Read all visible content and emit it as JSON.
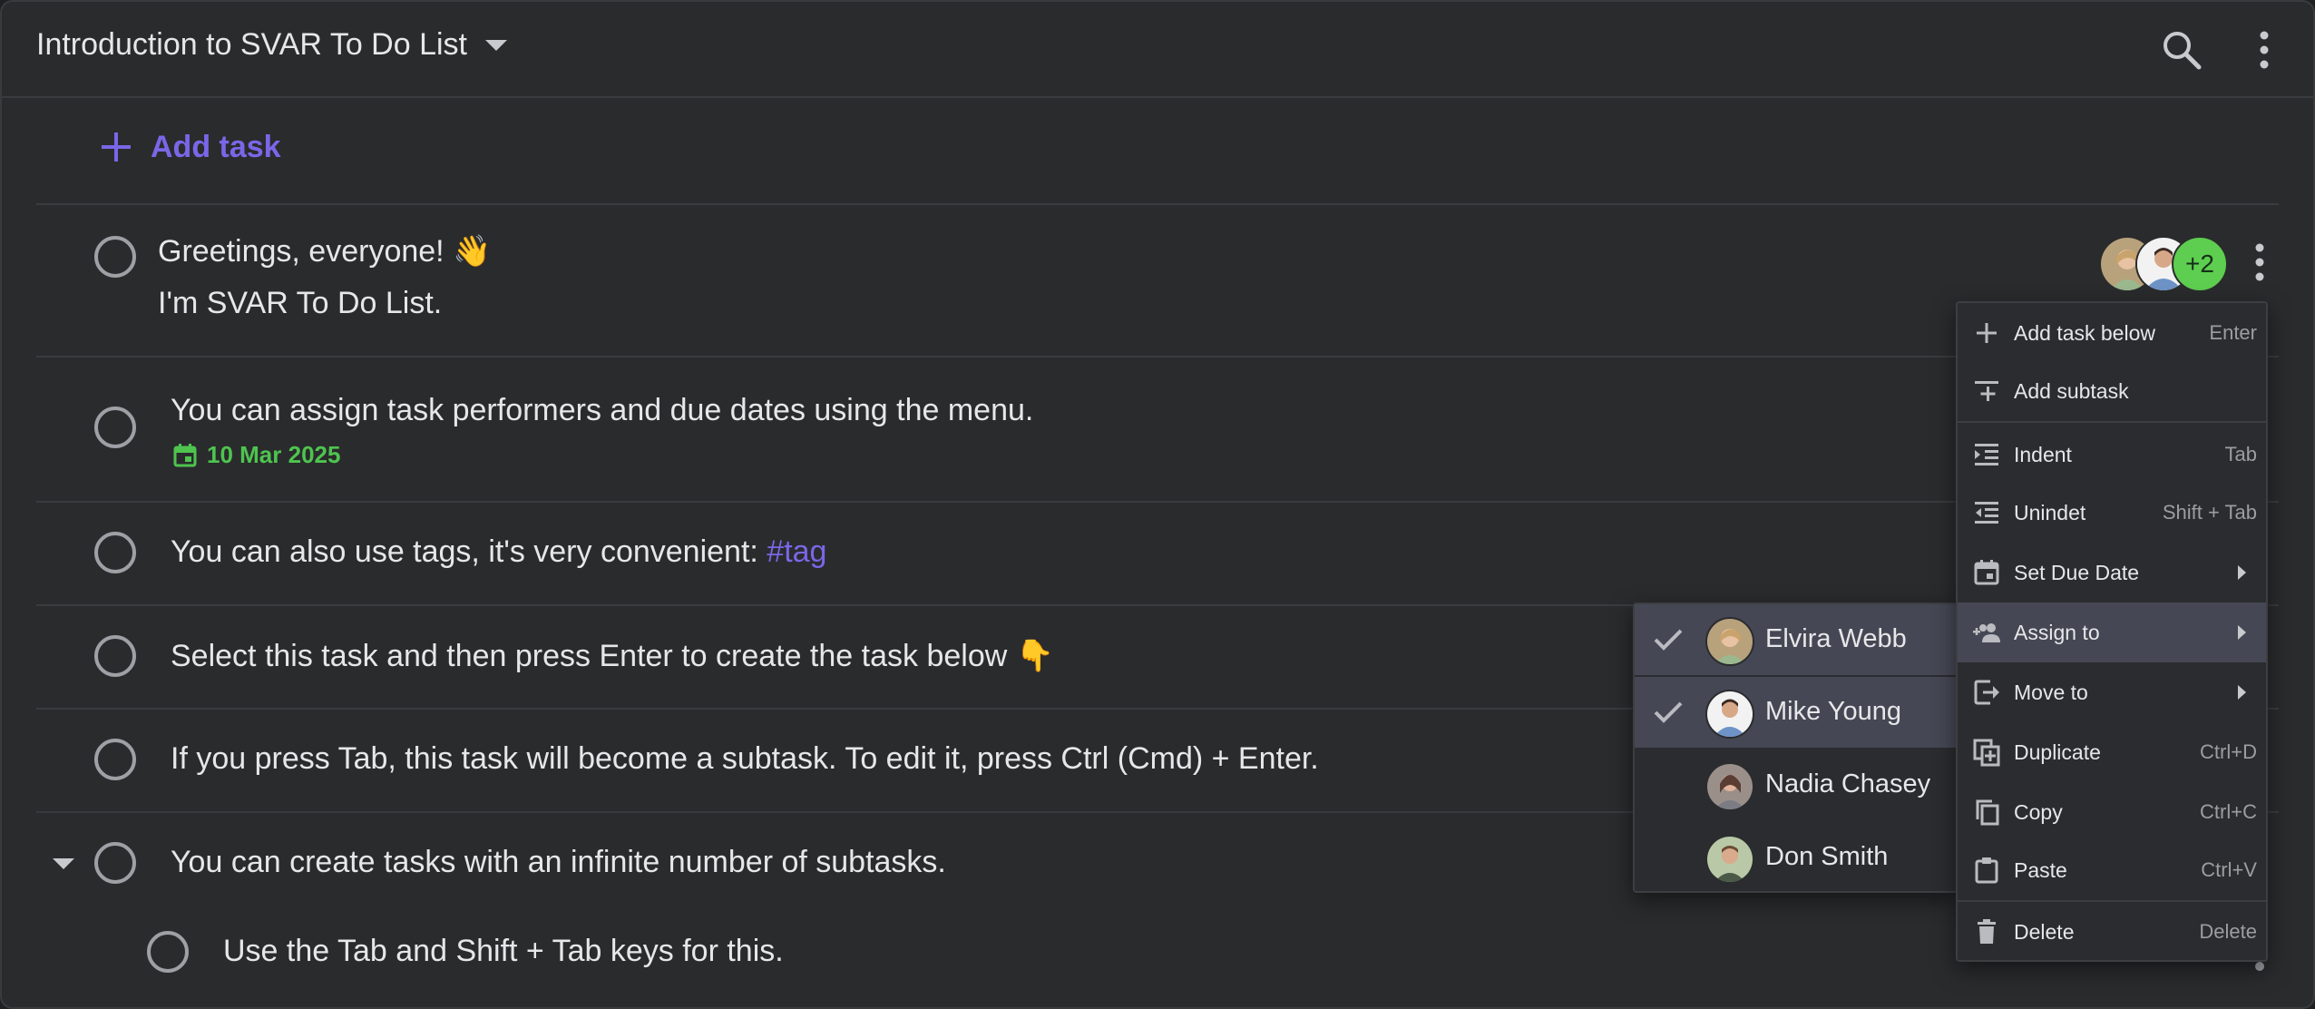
{
  "header": {
    "title": "Introduction to SVAR To Do List",
    "search_icon": "search-icon",
    "more_icon": "more-vertical-icon"
  },
  "add_task_label": "Add task",
  "tasks": [
    {
      "line1": "Greetings, everyone! 👋",
      "line2": "I'm SVAR To Do List."
    },
    {
      "text": "You can assign task performers and due dates using the menu.",
      "due": "10 Mar 2025"
    },
    {
      "text": "You can also use tags, it's very convenient: ",
      "tag": "#tag"
    },
    {
      "text": "Select this task and then press Enter to create the task below 👇"
    },
    {
      "text": "If you press Tab, this task will become a subtask. To edit it, press Ctrl (Cmd) + Enter."
    },
    {
      "text": "You can create tasks with an infinite number of subtasks."
    },
    {
      "text": "Use the Tab and Shift + Tab keys for this."
    }
  ],
  "assignees_extra": "+2",
  "context_menu": [
    {
      "label": "Add task below",
      "shortcut": "Enter",
      "icon": "plus-icon"
    },
    {
      "label": "Add subtask",
      "shortcut": "",
      "icon": "add-subtask-icon"
    },
    {
      "label": "Indent",
      "shortcut": "Tab",
      "icon": "indent-icon"
    },
    {
      "label": "Unindet",
      "shortcut": "Shift + Tab",
      "icon": "unindent-icon"
    },
    {
      "label": "Set Due Date",
      "shortcut": "",
      "icon": "calendar-icon"
    },
    {
      "label": "Assign to",
      "shortcut": "",
      "icon": "assign-people-icon"
    },
    {
      "label": "Move to",
      "shortcut": "",
      "icon": "move-to-icon"
    },
    {
      "label": "Duplicate",
      "shortcut": "Ctrl+D",
      "icon": "duplicate-icon"
    },
    {
      "label": "Copy",
      "shortcut": "Ctrl+C",
      "icon": "copy-icon"
    },
    {
      "label": "Paste",
      "shortcut": "Ctrl+V",
      "icon": "paste-icon"
    },
    {
      "label": "Delete",
      "shortcut": "Delete",
      "icon": "trash-icon"
    }
  ],
  "assign_submenu": [
    {
      "name": "Elvira Webb",
      "selected": true
    },
    {
      "name": "Mike Young",
      "selected": true
    },
    {
      "name": "Nadia Chasey",
      "selected": false
    },
    {
      "name": "Don Smith",
      "selected": false
    }
  ],
  "colors": {
    "accent": "#7b66e8",
    "due": "#4ec44e",
    "count_badge": "#5dce4f",
    "background": "#2a2b2d"
  }
}
